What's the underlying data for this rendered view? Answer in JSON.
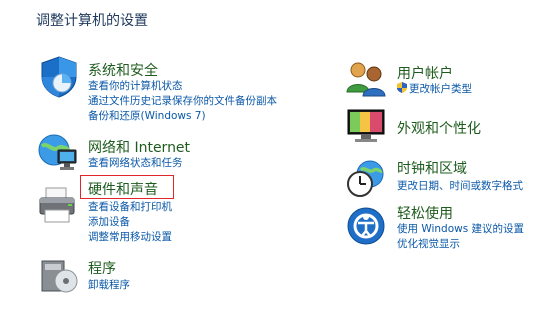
{
  "window": {
    "title": "调整计算机的设置"
  },
  "left": [
    {
      "id": "system",
      "title": "系统和安全",
      "links": [
        "查看你的计算机状态",
        "通过文件历史记录保存你的文件备份副本",
        "备份和还原(Windows 7)"
      ]
    },
    {
      "id": "network",
      "title": "网络和 Internet",
      "links": [
        "查看网络状态和任务"
      ]
    },
    {
      "id": "hardware",
      "title": "硬件和声音",
      "links": [
        "查看设备和打印机",
        "添加设备",
        "调整常用移动设置"
      ]
    },
    {
      "id": "programs",
      "title": "程序",
      "links": [
        "卸载程序"
      ]
    }
  ],
  "right": [
    {
      "id": "accounts",
      "title": "用户帐户",
      "links": [
        "更改帐户类型"
      ]
    },
    {
      "id": "appearance",
      "title": "外观和个性化",
      "links": []
    },
    {
      "id": "clock",
      "title": "时钟和区域",
      "links": [
        "更改日期、时间或数字格式"
      ]
    },
    {
      "id": "ease",
      "title": "轻松使用",
      "links": [
        "使用 Windows 建议的设置",
        "优化视觉显示"
      ]
    }
  ],
  "highlight": {
    "target": "hardware",
    "color": "#e0262a"
  },
  "colors": {
    "heading": "#1e5c1e",
    "link": "#0a58a8",
    "title": "#1e395b"
  },
  "icons": {
    "system": "shield-icon",
    "network": "network-globe-icon",
    "hardware": "printer-icon",
    "programs": "program-disk-icon",
    "accounts": "users-icon",
    "appearance": "monitor-icon",
    "clock": "clock-globe-icon",
    "ease": "ease-of-access-icon",
    "uac": "uac-shield-icon"
  }
}
